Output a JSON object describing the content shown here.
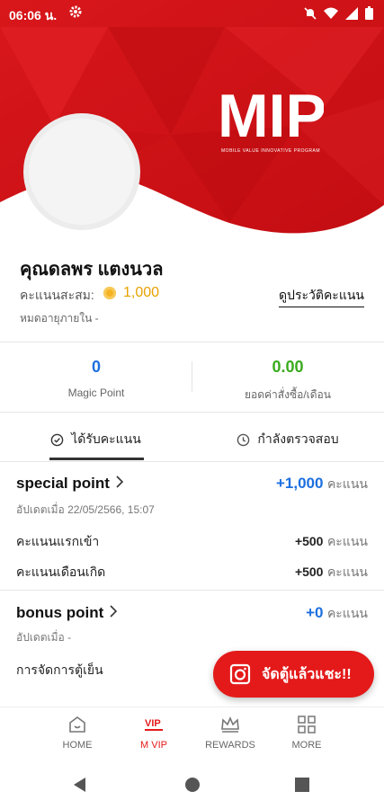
{
  "status_bar": {
    "time": "06:06 น."
  },
  "logo": {
    "text": "MIP",
    "tagline": "MOBILE VALUE INNOVATIVE PROGRAM"
  },
  "profile": {
    "name": "คุณดลพร แตงนวล",
    "points_label": "คะแนนสะสม:",
    "points_value": "1,000",
    "history_link": "ดูประวัติคะแนน",
    "expire_text": "หมดอายุภายใน -"
  },
  "stats": [
    {
      "value": "0",
      "label": "Magic Point",
      "color": "#1d6fe0"
    },
    {
      "value": "0.00",
      "label": "ยอดค่าสั่งซื้อ/เดือน",
      "color": "#3bab1f"
    }
  ],
  "tabs": [
    {
      "label": "ได้รับคะแนน",
      "icon": "check-circle-icon",
      "active": true
    },
    {
      "label": "กำลังตรวจสอบ",
      "icon": "clock-icon",
      "active": false
    }
  ],
  "sections": [
    {
      "title": "special point",
      "value": "+1,000",
      "unit": "คะแนน",
      "subtitle": "อัปเดตเมื่อ 22/05/2566, 15:07",
      "rows": [
        {
          "label": "คะแนนแรกเข้า",
          "value": "+500",
          "unit": "คะแนน"
        },
        {
          "label": "คะแนนเดือนเกิด",
          "value": "+500",
          "unit": "คะแนน"
        }
      ]
    },
    {
      "title": "bonus point",
      "value": "+0",
      "unit": "คะแนน",
      "subtitle": "อัปเดตเมื่อ -",
      "rows": [
        {
          "label": "การจัดการตู้เย็น",
          "value": "",
          "unit": ""
        }
      ]
    }
  ],
  "fab": {
    "label": "จัดตู้แล้วแชะ!!",
    "icon": "camera-icon"
  },
  "bottom_nav": [
    {
      "label": "HOME",
      "icon": "home-icon",
      "active": false
    },
    {
      "label": "M VIP",
      "icon": "vip-icon",
      "active": true
    },
    {
      "label": "REWARDS",
      "icon": "crown-icon",
      "active": false
    },
    {
      "label": "MORE",
      "icon": "grid-icon",
      "active": false
    }
  ],
  "colors": {
    "brand_red": "#e41a1a",
    "active_nav": "#e41a1a",
    "point_orange": "#e8a100"
  }
}
